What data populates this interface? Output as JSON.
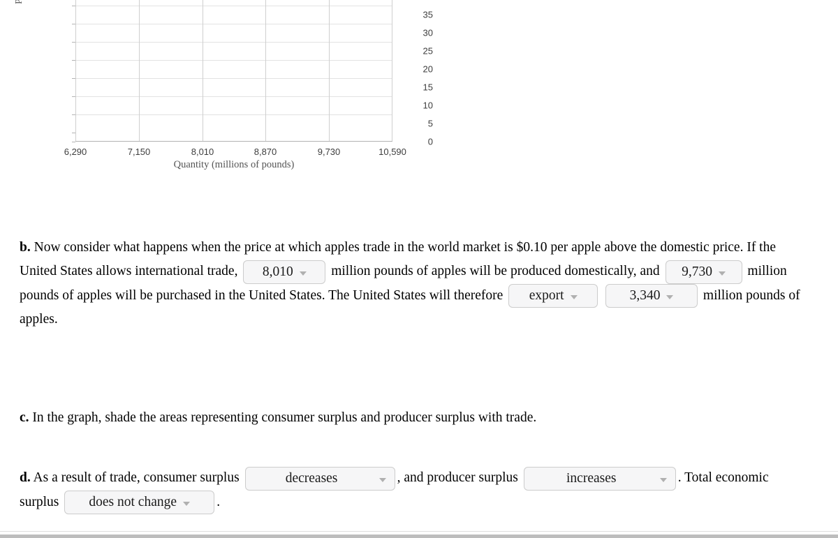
{
  "chart_data": {
    "type": "line",
    "title": "",
    "xlabel": "Quantity (millions of pounds)",
    "ylabel": "Price",
    "x_tick_labels": [
      "6,290",
      "7,150",
      "8,010",
      "8,870",
      "9,730",
      "10,590"
    ],
    "x_tick_values": [
      6290,
      7150,
      8010,
      8870,
      9730,
      10590
    ],
    "y_tick_labels": [
      "0",
      "5",
      "10",
      "15",
      "20",
      "25",
      "30",
      "35"
    ],
    "y_tick_values": [
      0,
      5,
      10,
      15,
      20,
      25,
      30,
      35
    ],
    "xlim": [
      6290,
      10590
    ],
    "ylim": [
      0,
      38
    ],
    "grid": true,
    "legend": "none",
    "series": [],
    "note": "empty plot area - grid only, no data plotted"
  },
  "question_b": {
    "letter": "b.",
    "text_1": "Now consider what happens when the price at which apples trade in the world market is $0.10 per apple above the domestic price. If the United States allows international trade,",
    "dropdown_1": {
      "value": "8,010",
      "name": "domestic-production-dropdown"
    },
    "text_2": "million pounds of apples will be produced domestically, and",
    "dropdown_2": {
      "value": "9,730",
      "name": "domestic-purchase-dropdown"
    },
    "text_3": "million pounds of apples will be purchased in the United States. The United States will therefore",
    "dropdown_3": {
      "value": "export",
      "name": "trade-direction-dropdown"
    },
    "dropdown_4": {
      "value": "3,340",
      "name": "trade-quantity-dropdown"
    },
    "text_4": "million pounds of apples."
  },
  "question_c": {
    "letter": "c.",
    "text": "In the graph, shade the areas representing consumer surplus and producer surplus with trade."
  },
  "question_d": {
    "letter": "d.",
    "text_1": "As a result of trade, consumer surplus",
    "dropdown_1": {
      "value": "decreases",
      "name": "consumer-surplus-dropdown"
    },
    "text_2": ", and producer surplus",
    "dropdown_2": {
      "value": "increases",
      "name": "producer-surplus-dropdown"
    },
    "text_3": ". Total economic surplus",
    "dropdown_3": {
      "value": "does not change",
      "name": "total-surplus-dropdown"
    },
    "text_4": "."
  },
  "colors": {
    "grid_horizontal": "#e2e2e2",
    "grid_vertical": "#cfcfcf",
    "axis": "#b3b3b3",
    "tick_text": "#3d3d3d",
    "axis_label_text": "#555555",
    "dropdown_fill": "#f6f6f7",
    "dropdown_border": "#cccccc",
    "dropdown_caret": "#b0b0b0",
    "body_text": "#000000"
  }
}
